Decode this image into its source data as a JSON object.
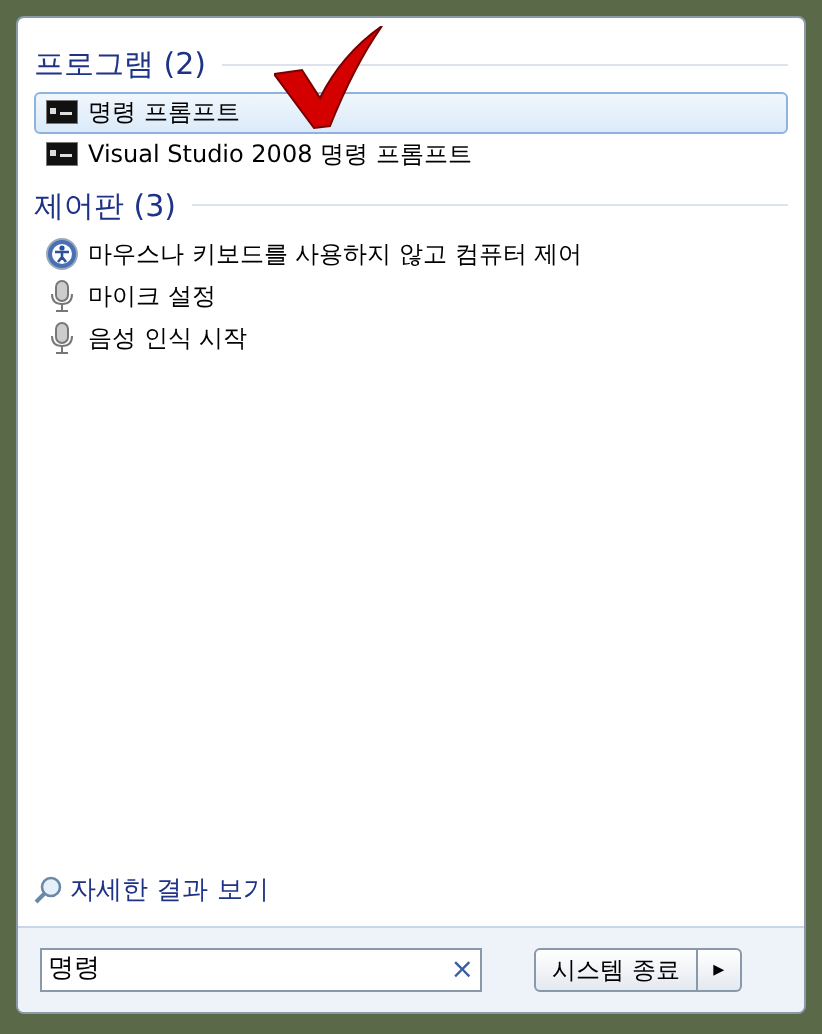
{
  "groups": [
    {
      "title": "프로그램 (2)",
      "items": [
        {
          "label": "명령 프롬프트",
          "kind": "console",
          "selected": true
        },
        {
          "label": "Visual Studio 2008 명령 프롬프트",
          "kind": "console",
          "selected": false
        }
      ]
    },
    {
      "title": "제어판 (3)",
      "items": [
        {
          "label": "마우스나 키보드를 사용하지 않고 컴퓨터 제어",
          "kind": "access",
          "selected": false
        },
        {
          "label": "마이크 설정",
          "kind": "mic",
          "selected": false
        },
        {
          "label": "음성 인식 시작",
          "kind": "mic",
          "selected": false
        }
      ]
    }
  ],
  "more_results": "자세한 결과 보기",
  "search": {
    "value": "명령",
    "clear": "×"
  },
  "shutdown": {
    "label": "시스템 종료",
    "arrow": "▸"
  }
}
